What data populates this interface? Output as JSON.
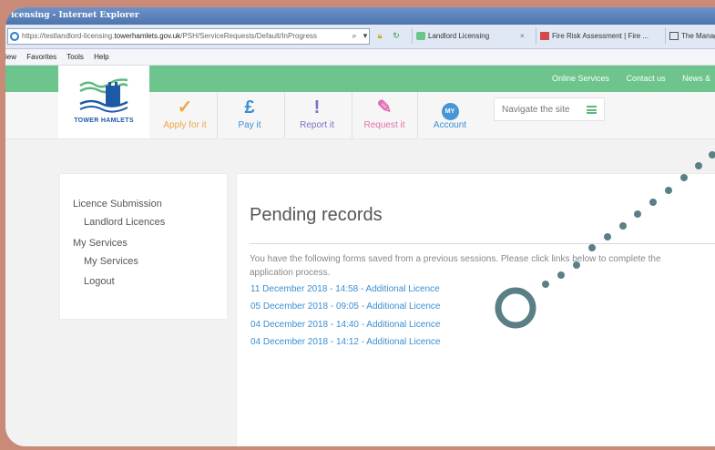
{
  "window": {
    "title": "icensing - Internet Explorer"
  },
  "address_bar": {
    "url_prefix": "https://testlandlord-licensing.",
    "url_host": "towerhamlets.gov.uk",
    "url_path": "/PSH/ServiceRequests/Default/InProgress",
    "search_icon": "search-icon",
    "dropdown_icon": "chevron-down-icon",
    "lock_icon": "lock-icon",
    "refresh_icon": "refresh-icon"
  },
  "tabs": [
    {
      "label": "Landlord Licensing",
      "close": "×"
    },
    {
      "label": "Fire Risk Assessment | Fire ..."
    },
    {
      "label": "The Manag"
    }
  ],
  "menu": [
    "iew",
    "Favorites",
    "Tools",
    "Help"
  ],
  "top_nav": [
    "Online Services",
    "Contact us",
    "News &"
  ],
  "logo": {
    "text": "TOWER HAMLETS"
  },
  "nav_buttons": [
    {
      "icon": "✓",
      "label": "Apply for it",
      "color": "#f0a64b"
    },
    {
      "icon": "£",
      "label": "Pay it",
      "color": "#3c8fd2"
    },
    {
      "icon": "!",
      "label": "Report it",
      "color": "#7d6fc8"
    },
    {
      "icon": "✎",
      "label": "Request it",
      "color": "#e26fb2"
    },
    {
      "icon": "MY",
      "label": "Account",
      "color": "#3c8fd2"
    }
  ],
  "navigate_site": {
    "label": "Navigate the site"
  },
  "sidebar": {
    "items": [
      {
        "label": "Licence Submission",
        "level": 0
      },
      {
        "label": "Landlord Licences",
        "level": 1
      },
      {
        "label": "My Services",
        "level": 0
      },
      {
        "label": "My Services",
        "level": 1
      },
      {
        "label": "Logout",
        "level": 1
      }
    ]
  },
  "main": {
    "title": "Pending records",
    "intro": "You have the following forms saved from a previous sessions. Please click links below to complete the application process.",
    "records": [
      "11 December 2018 - 14:58 - Additional Licence",
      "05 December 2018 - 09:05 - Additional Licence",
      "04 December 2018 - 14:40 - Additional Licence",
      "04 December 2018 - 14:12 - Additional Licence"
    ]
  },
  "colors": {
    "frame": "#c98a78",
    "green": "#6dc48c",
    "link": "#3a8fd3",
    "dots": "#5b7f86"
  }
}
